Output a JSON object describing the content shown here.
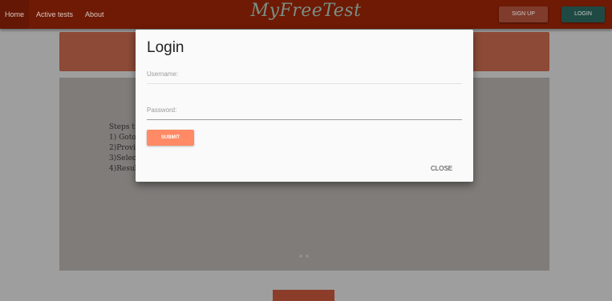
{
  "nav": {
    "links": [
      "Home",
      "Active tests",
      "About"
    ],
    "brand": "MyFreeTest",
    "signup_label": "SIGN UP",
    "login_label": "LOGIN"
  },
  "background": {
    "steps": [
      "Steps t",
      "1) Goto",
      "2)Provi",
      "3)Selec",
      "4)Resul"
    ]
  },
  "modal": {
    "title": "Login",
    "username_label": "Username:",
    "password_label": "Password:",
    "submit_label": "SUBMIT",
    "close_label": "CLOSE"
  },
  "colors": {
    "navbar": "#6e1a05",
    "submit": "#ff8a65",
    "login_button": "#1f4a43"
  }
}
